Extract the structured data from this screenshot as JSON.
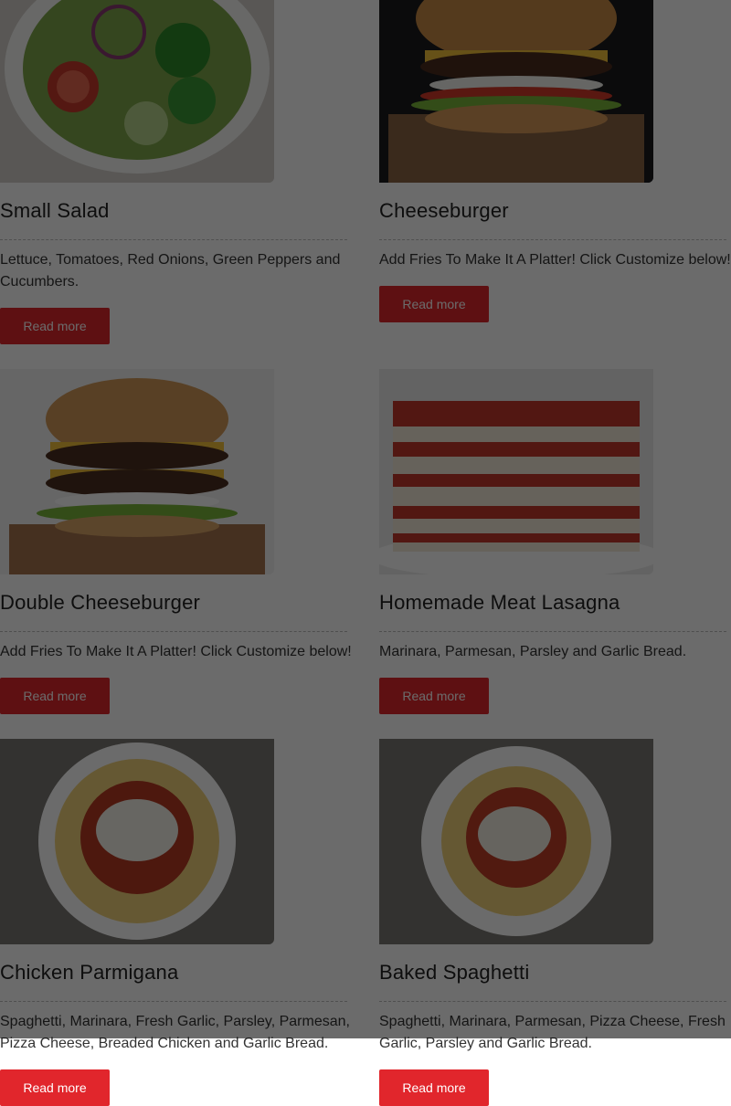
{
  "menu_items": [
    {
      "title": "Small Salad",
      "description": "Lettuce, Tomatoes, Red Onions, Green Peppers and Cucumbers.",
      "button": "Read more",
      "image_icon": "salad-image"
    },
    {
      "title": "Cheeseburger",
      "description": "Add Fries To Make It A Platter! Click Customize below!",
      "button": "Read more",
      "image_icon": "cheeseburger-image"
    },
    {
      "title": "Double Cheeseburger",
      "description": "Add Fries To Make It A Platter! Click Customize below!",
      "button": "Read more",
      "image_icon": "double-cheeseburger-image"
    },
    {
      "title": "Homemade Meat Lasagna",
      "description": "Marinara, Parmesan, Parsley and Garlic Bread.",
      "button": "Read more",
      "image_icon": "lasagna-image"
    },
    {
      "title": "Chicken Parmigana",
      "description": "Spaghetti, Marinara, Fresh Garlic, Parsley, Parmesan, Pizza Cheese, Breaded Chicken and Garlic Bread.",
      "button": "Read more",
      "image_icon": "spaghetti-image"
    },
    {
      "title": "Baked Spaghetti",
      "description": "Spaghetti, Marinara, Parmesan, Pizza Cheese, Fresh Garlic, Parsley and Garlic Bread.",
      "button": "Read more",
      "image_icon": "spaghetti-image"
    }
  ],
  "colors": {
    "button": "#e1262c",
    "overlay": "rgba(0,0,0,0.58)"
  }
}
